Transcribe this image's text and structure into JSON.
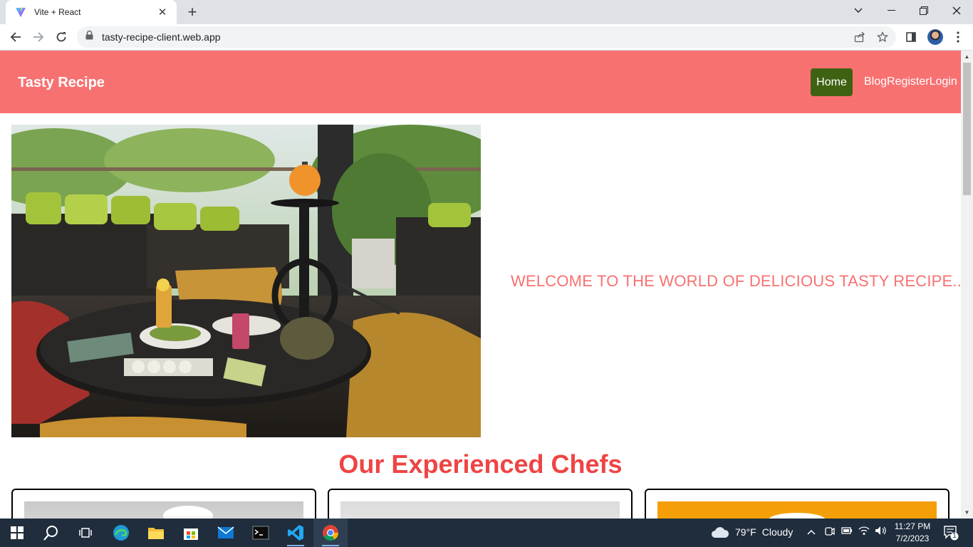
{
  "browser": {
    "tab_title": "Vite + React",
    "url": "tasty-recipe-client.web.app"
  },
  "site": {
    "brand": "Tasty Recipe",
    "nav": {
      "home": "Home",
      "links": "BlogRegisterLogin"
    },
    "hero": {
      "welcome": "WELCOME TO THE WORLD OF DELICIOUS TASTY RECIPE...."
    },
    "chefs": {
      "title": "Our Experienced Chefs"
    }
  },
  "colors": {
    "navbar": "#f87171",
    "home_button": "#3f6212",
    "accent_text": "#f87171",
    "section_title": "#ef4444"
  },
  "taskbar": {
    "weather": {
      "temperature": "79°F",
      "condition": "Cloudy"
    },
    "clock": {
      "time": "11:27 PM",
      "date": "7/2/2023"
    },
    "notification_count": "1"
  }
}
